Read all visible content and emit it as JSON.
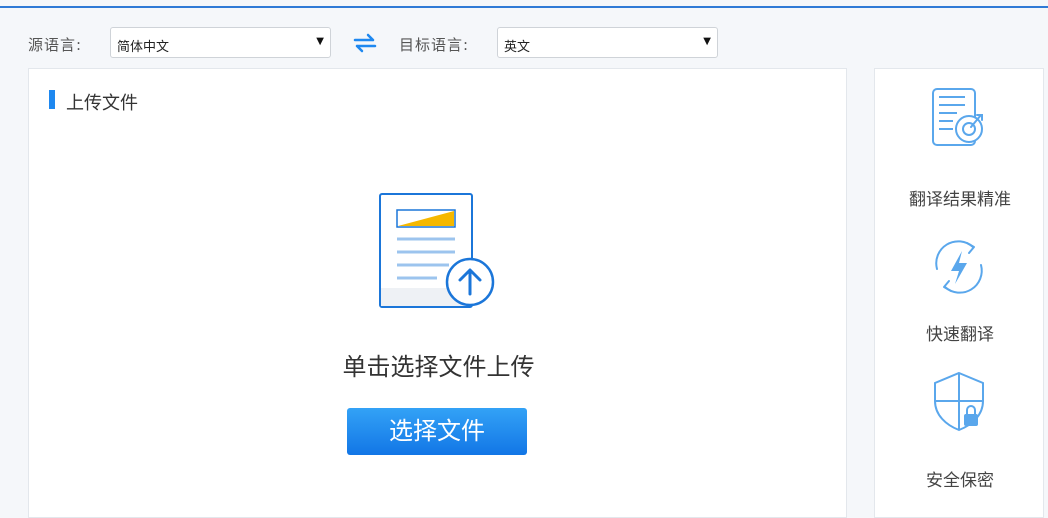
{
  "lang_bar": {
    "source_label": "源语言:",
    "source_value": "简体中文",
    "target_label": "目标语言:",
    "target_value": "英文",
    "dropdown_arrow": "▼",
    "swap_icon": "swap-arrows-icon"
  },
  "upload": {
    "title": "上传文件",
    "hint": "单击选择文件上传",
    "button_label": "选择文件"
  },
  "features": {
    "items": [
      {
        "label": "翻译结果精准",
        "icon": "document-accuracy-icon"
      },
      {
        "label": "快速翻译",
        "icon": "lightning-icon"
      },
      {
        "label": "安全保密",
        "icon": "shield-lock-icon"
      }
    ]
  },
  "colors": {
    "accent": "#1e88f0",
    "button_top": "#33a2f6",
    "button_bottom": "#1276e6",
    "icon_line": "#5aa7ec"
  }
}
